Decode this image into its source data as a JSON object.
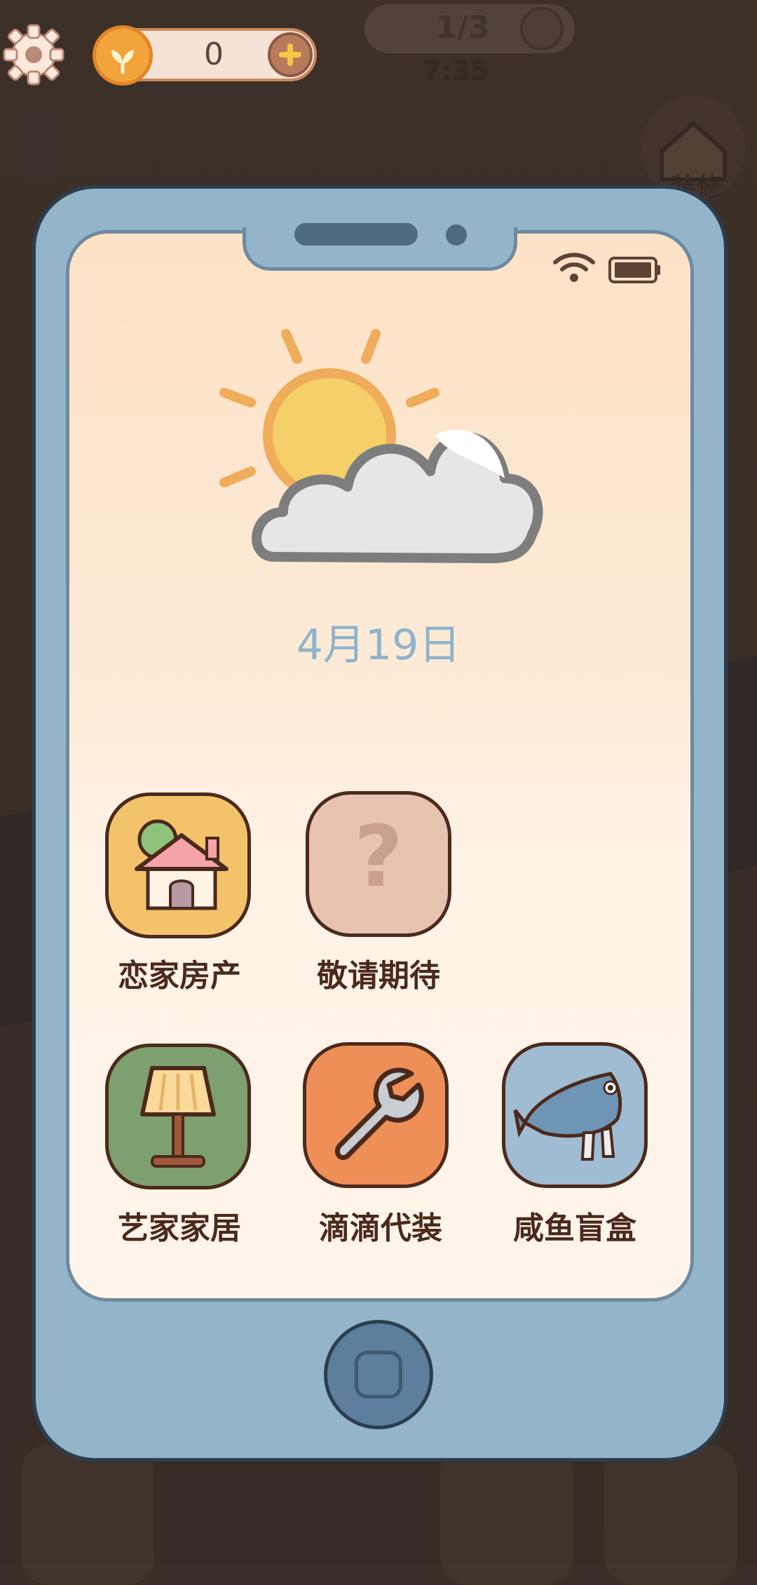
{
  "top_bar": {
    "coins": {
      "count": "0"
    },
    "energy": {
      "value": "1/3",
      "timer": "7:35"
    }
  },
  "background": {
    "renovate_label": "装修"
  },
  "phone": {
    "date": "4月19日",
    "apps": [
      {
        "label": "恋家房产",
        "icon": "house-icon",
        "color": "#f3c36b"
      },
      {
        "label": "敬请期待",
        "icon": "question-mark-icon",
        "color": "#e8c3b0"
      },
      {
        "label": "艺家家居",
        "icon": "lamp-icon",
        "color": "#7ea06e"
      },
      {
        "label": "滴滴代装",
        "icon": "wrench-icon",
        "color": "#ef8f58"
      },
      {
        "label": "咸鱼盲盒",
        "icon": "fish-icon",
        "color": "#9fbcd3"
      }
    ]
  }
}
